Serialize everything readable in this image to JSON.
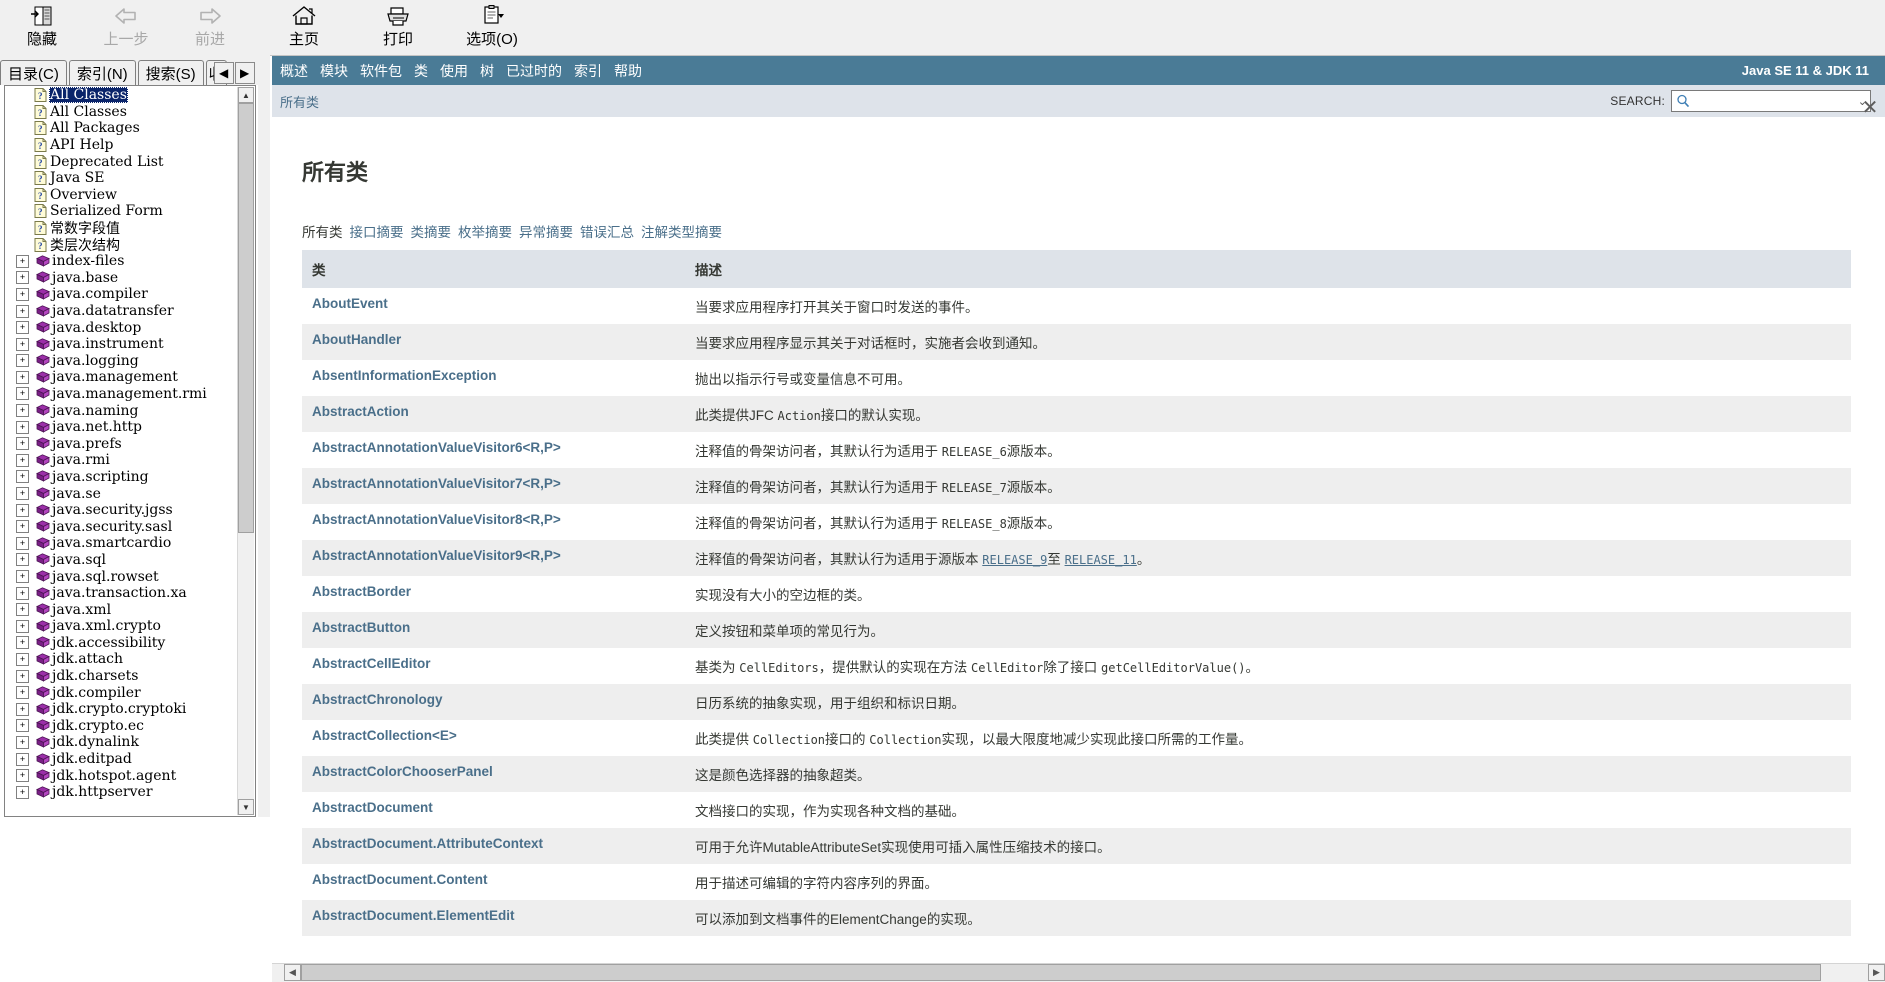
{
  "toolbar": {
    "buttons": [
      {
        "label": "隐藏",
        "icon": "hide-pane-icon",
        "disabled": false
      },
      {
        "label": "上一步",
        "icon": "back-arrow-icon",
        "disabled": true
      },
      {
        "label": "前进",
        "icon": "forward-arrow-icon",
        "disabled": true
      },
      {
        "label": "主页",
        "icon": "home-icon",
        "disabled": false
      },
      {
        "label": "打印",
        "icon": "printer-icon",
        "disabled": false
      },
      {
        "label": "选项(O)",
        "icon": "options-icon",
        "disabled": false
      }
    ]
  },
  "tabs": [
    {
      "label": "目录(C)",
      "selected": true
    },
    {
      "label": "索引(N)",
      "selected": false
    },
    {
      "label": "搜索(S)",
      "selected": false
    },
    {
      "label": "收",
      "selected": false
    }
  ],
  "nav_arrows": {
    "prev": "◀",
    "next": "▶"
  },
  "tree": {
    "items": [
      {
        "label": "All Classes",
        "icon": "page-question-icon",
        "expander": "",
        "selected": true
      },
      {
        "label": "All Classes",
        "icon": "page-question-icon",
        "expander": "",
        "selected": false
      },
      {
        "label": "All Packages",
        "icon": "page-question-icon",
        "expander": "",
        "selected": false
      },
      {
        "label": "API Help",
        "icon": "page-question-icon",
        "expander": "",
        "selected": false
      },
      {
        "label": "Deprecated List",
        "icon": "page-question-icon",
        "expander": "",
        "selected": false
      },
      {
        "label": "Java SE",
        "icon": "page-question-icon",
        "expander": "",
        "selected": false
      },
      {
        "label": "Overview",
        "icon": "page-question-icon",
        "expander": "",
        "selected": false
      },
      {
        "label": "Serialized Form",
        "icon": "page-question-icon",
        "expander": "",
        "selected": false
      },
      {
        "label": "常数字段值",
        "icon": "page-question-icon",
        "expander": "",
        "selected": false
      },
      {
        "label": "类层次结构",
        "icon": "page-question-icon",
        "expander": "",
        "selected": false
      },
      {
        "label": "index-files",
        "icon": "book-icon",
        "expander": "+",
        "selected": false
      },
      {
        "label": "java.base",
        "icon": "book-icon",
        "expander": "+",
        "selected": false
      },
      {
        "label": "java.compiler",
        "icon": "book-icon",
        "expander": "+",
        "selected": false
      },
      {
        "label": "java.datatransfer",
        "icon": "book-icon",
        "expander": "+",
        "selected": false
      },
      {
        "label": "java.desktop",
        "icon": "book-icon",
        "expander": "+",
        "selected": false
      },
      {
        "label": "java.instrument",
        "icon": "book-icon",
        "expander": "+",
        "selected": false
      },
      {
        "label": "java.logging",
        "icon": "book-icon",
        "expander": "+",
        "selected": false
      },
      {
        "label": "java.management",
        "icon": "book-icon",
        "expander": "+",
        "selected": false
      },
      {
        "label": "java.management.rmi",
        "icon": "book-icon",
        "expander": "+",
        "selected": false
      },
      {
        "label": "java.naming",
        "icon": "book-icon",
        "expander": "+",
        "selected": false
      },
      {
        "label": "java.net.http",
        "icon": "book-icon",
        "expander": "+",
        "selected": false
      },
      {
        "label": "java.prefs",
        "icon": "book-icon",
        "expander": "+",
        "selected": false
      },
      {
        "label": "java.rmi",
        "icon": "book-icon",
        "expander": "+",
        "selected": false
      },
      {
        "label": "java.scripting",
        "icon": "book-icon",
        "expander": "+",
        "selected": false
      },
      {
        "label": "java.se",
        "icon": "book-icon",
        "expander": "+",
        "selected": false
      },
      {
        "label": "java.security.jgss",
        "icon": "book-icon",
        "expander": "+",
        "selected": false
      },
      {
        "label": "java.security.sasl",
        "icon": "book-icon",
        "expander": "+",
        "selected": false
      },
      {
        "label": "java.smartcardio",
        "icon": "book-icon",
        "expander": "+",
        "selected": false
      },
      {
        "label": "java.sql",
        "icon": "book-icon",
        "expander": "+",
        "selected": false
      },
      {
        "label": "java.sql.rowset",
        "icon": "book-icon",
        "expander": "+",
        "selected": false
      },
      {
        "label": "java.transaction.xa",
        "icon": "book-icon",
        "expander": "+",
        "selected": false
      },
      {
        "label": "java.xml",
        "icon": "book-icon",
        "expander": "+",
        "selected": false
      },
      {
        "label": "java.xml.crypto",
        "icon": "book-icon",
        "expander": "+",
        "selected": false
      },
      {
        "label": "jdk.accessibility",
        "icon": "book-icon",
        "expander": "+",
        "selected": false
      },
      {
        "label": "jdk.attach",
        "icon": "book-icon",
        "expander": "+",
        "selected": false
      },
      {
        "label": "jdk.charsets",
        "icon": "book-icon",
        "expander": "+",
        "selected": false
      },
      {
        "label": "jdk.compiler",
        "icon": "book-icon",
        "expander": "+",
        "selected": false
      },
      {
        "label": "jdk.crypto.cryptoki",
        "icon": "book-icon",
        "expander": "+",
        "selected": false
      },
      {
        "label": "jdk.crypto.ec",
        "icon": "book-icon",
        "expander": "+",
        "selected": false
      },
      {
        "label": "jdk.dynalink",
        "icon": "book-icon",
        "expander": "+",
        "selected": false
      },
      {
        "label": "jdk.editpad",
        "icon": "book-icon",
        "expander": "+",
        "selected": false
      },
      {
        "label": "jdk.hotspot.agent",
        "icon": "book-icon",
        "expander": "+",
        "selected": false
      },
      {
        "label": "jdk.httpserver",
        "icon": "book-icon",
        "expander": "+",
        "selected": false
      }
    ]
  },
  "doc": {
    "topnav": {
      "links": [
        "概述",
        "模块",
        "软件包",
        "类",
        "使用",
        "树",
        "已过时的",
        "索引",
        "帮助"
      ],
      "product": "Java SE 11 & JDK 11",
      "bg_color": "#4a7b96"
    },
    "subnav": {
      "breadcrumb": "所有类",
      "search_label": "SEARCH:",
      "search_value": "",
      "search_placeholder": "",
      "search_icon": "magnifier-icon",
      "close_icon": "close-icon"
    },
    "title": "所有类",
    "summary_links": [
      {
        "label": "所有类",
        "current": true
      },
      {
        "label": "接口摘要",
        "current": false
      },
      {
        "label": "类摘要",
        "current": false
      },
      {
        "label": "枚举摘要",
        "current": false
      },
      {
        "label": "异常摘要",
        "current": false
      },
      {
        "label": "错误汇总",
        "current": false
      },
      {
        "label": "注解类型摘要",
        "current": false
      }
    ],
    "table": {
      "headers": [
        "类",
        "描述"
      ],
      "rows": [
        {
          "cls": "AboutEvent",
          "desc_parts": [
            {
              "t": "text",
              "v": "当要求应用程序打开其关于窗口时发送的事件。"
            }
          ]
        },
        {
          "cls": "AboutHandler",
          "desc_parts": [
            {
              "t": "text",
              "v": "当要求应用程序显示其关于对话框时，实施者会收到通知。"
            }
          ]
        },
        {
          "cls": "AbsentInformationException",
          "desc_parts": [
            {
              "t": "text",
              "v": "抛出以指示行号或变量信息不可用。"
            }
          ]
        },
        {
          "cls": "AbstractAction",
          "desc_parts": [
            {
              "t": "text",
              "v": "此类提供JFC "
            },
            {
              "t": "code",
              "v": "Action"
            },
            {
              "t": "text",
              "v": "接口的默认实现。"
            }
          ]
        },
        {
          "cls": "AbstractAnnotationValueVisitor6<R,P>",
          "desc_parts": [
            {
              "t": "text",
              "v": "注释值的骨架访问者，其默认行为适用于 "
            },
            {
              "t": "code",
              "v": "RELEASE_6"
            },
            {
              "t": "text",
              "v": "源版本。"
            }
          ]
        },
        {
          "cls": "AbstractAnnotationValueVisitor7<R,P>",
          "desc_parts": [
            {
              "t": "text",
              "v": "注释值的骨架访问者，其默认行为适用于 "
            },
            {
              "t": "code",
              "v": "RELEASE_7"
            },
            {
              "t": "text",
              "v": "源版本。"
            }
          ]
        },
        {
          "cls": "AbstractAnnotationValueVisitor8<R,P>",
          "desc_parts": [
            {
              "t": "text",
              "v": "注释值的骨架访问者，其默认行为适用于 "
            },
            {
              "t": "code",
              "v": "RELEASE_8"
            },
            {
              "t": "text",
              "v": "源版本。"
            }
          ]
        },
        {
          "cls": "AbstractAnnotationValueVisitor9<R,P>",
          "desc_parts": [
            {
              "t": "text",
              "v": "注释值的骨架访问者，其默认行为适用于源版本 "
            },
            {
              "t": "codelink",
              "v": "RELEASE_9"
            },
            {
              "t": "text",
              "v": "至 "
            },
            {
              "t": "codelink",
              "v": "RELEASE_11"
            },
            {
              "t": "text",
              "v": "。"
            }
          ]
        },
        {
          "cls": "AbstractBorder",
          "desc_parts": [
            {
              "t": "text",
              "v": "实现没有大小的空边框的类。"
            }
          ]
        },
        {
          "cls": "AbstractButton",
          "desc_parts": [
            {
              "t": "text",
              "v": "定义按钮和菜单项的常见行为。"
            }
          ]
        },
        {
          "cls": "AbstractCellEditor",
          "desc_parts": [
            {
              "t": "text",
              "v": "基类为 "
            },
            {
              "t": "code",
              "v": "CellEditors"
            },
            {
              "t": "text",
              "v": "，提供默认的实现在方法 "
            },
            {
              "t": "code",
              "v": "CellEditor"
            },
            {
              "t": "text",
              "v": "除了接口 "
            },
            {
              "t": "code",
              "v": "getCellEditorValue()"
            },
            {
              "t": "text",
              "v": "。"
            }
          ]
        },
        {
          "cls": "AbstractChronology",
          "desc_parts": [
            {
              "t": "text",
              "v": "日历系统的抽象实现，用于组织和标识日期。"
            }
          ]
        },
        {
          "cls": "AbstractCollection<E>",
          "desc_parts": [
            {
              "t": "text",
              "v": "此类提供 "
            },
            {
              "t": "code",
              "v": "Collection"
            },
            {
              "t": "text",
              "v": "接口的 "
            },
            {
              "t": "code",
              "v": "Collection"
            },
            {
              "t": "text",
              "v": "实现，以最大限度地减少实现此接口所需的工作量。"
            }
          ]
        },
        {
          "cls": "AbstractColorChooserPanel",
          "desc_parts": [
            {
              "t": "text",
              "v": "这是颜色选择器的抽象超类。"
            }
          ]
        },
        {
          "cls": "AbstractDocument",
          "desc_parts": [
            {
              "t": "text",
              "v": "文档接口的实现，作为实现各种文档的基础。"
            }
          ]
        },
        {
          "cls": "AbstractDocument.AttributeContext",
          "desc_parts": [
            {
              "t": "text",
              "v": "可用于允许MutableAttributeSet实现使用可插入属性压缩技术的接口。"
            }
          ]
        },
        {
          "cls": "AbstractDocument.Content",
          "desc_parts": [
            {
              "t": "text",
              "v": "用于描述可编辑的字符内容序列的界面。"
            }
          ]
        },
        {
          "cls": "AbstractDocument.ElementEdit",
          "desc_parts": [
            {
              "t": "text",
              "v": "可以添加到文档事件的ElementChange的实现。"
            }
          ]
        }
      ]
    }
  },
  "scrollbars": {
    "tree_up": "▲",
    "tree_down": "▼",
    "doc_left": "◀",
    "doc_right": "▶"
  }
}
